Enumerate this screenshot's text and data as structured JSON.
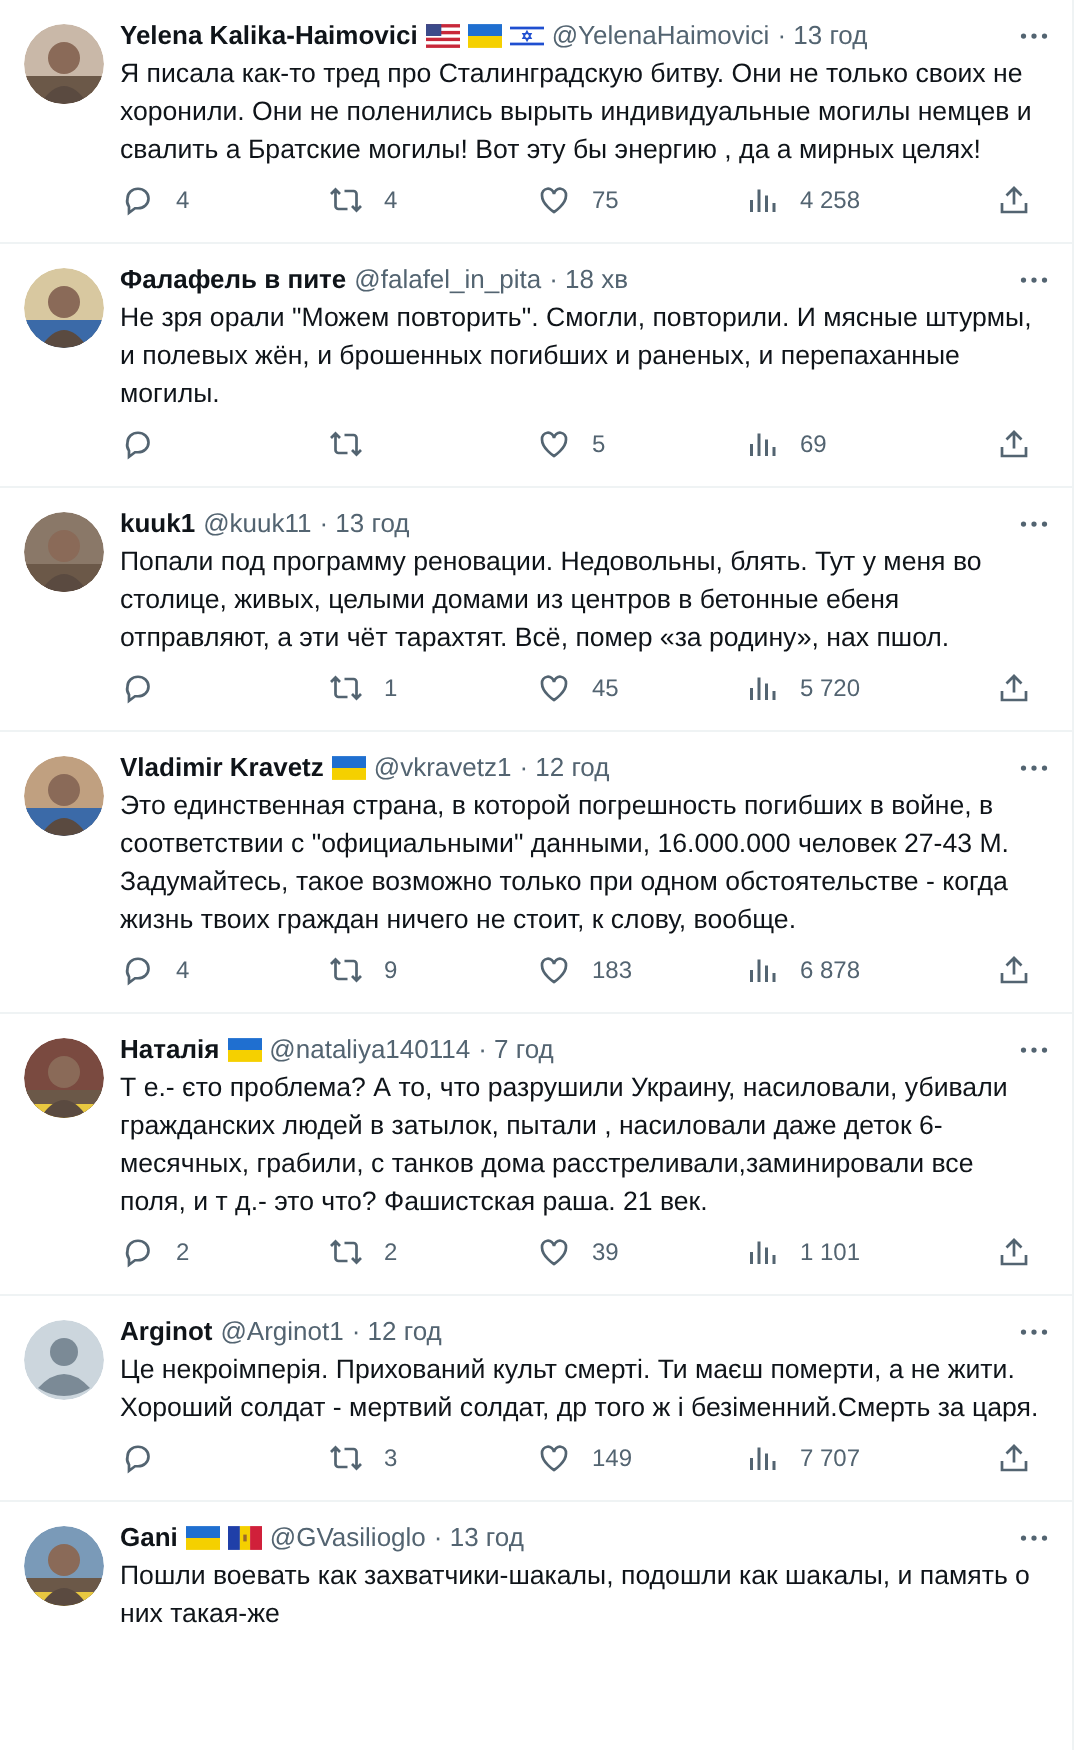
{
  "tweets": [
    {
      "name": "Yelena Kalika-Haimovici",
      "flags": [
        {
          "kind": "us"
        },
        {
          "kind": "ua"
        },
        {
          "kind": "il"
        }
      ],
      "handle": "@YelenaHaimovici",
      "time": "· 13 год",
      "avatar": {
        "kind": "picture"
      },
      "text": "Я писала как-то тред про Сталинградскую битву. Они не только своих не хоронили. Они не поленились вырыть индивидуальные могилы немцев и свалить а Братские могилы! Вот эту бы энергию , да а мирных целях!",
      "replies": "4",
      "retweets": "4",
      "likes": "75",
      "views": "4 258"
    },
    {
      "name": "Фалафель в пите",
      "handle": "@falafel_in_pita",
      "time": "· 18 хв",
      "avatar": {
        "kind": "picture"
      },
      "text": "Не зря орали \"Можем повторить\". Смогли, повторили. И мясные штурмы, и полевых жён, и брошенных погибших и раненых, и перепаханные могилы.",
      "likes": "5",
      "views": "69"
    },
    {
      "name": "kuuk1",
      "handle": "@kuuk11",
      "time": "· 13 год",
      "avatar": {
        "kind": "picture"
      },
      "text": "Попали под программу реновации. Недовольны, блять. Тут у меня во столице, живых, целыми домами из центров в бетонные ебеня отправляют, а эти чёт тарахтят. Всё, помер «за родину», нах пшол.",
      "retweets": "1",
      "likes": "45",
      "views": "5 720"
    },
    {
      "name": "Vladimir Kravetz",
      "flags": [
        {
          "kind": "ua"
        }
      ],
      "handle": "@vkravetz1",
      "time": "· 12 год",
      "avatar": {
        "kind": "picture"
      },
      "text": "Это единственная страна, в которой погрешность погибших в войне, в соответствии с \"официальными\" данными, 16.000.000 человек 27-43 М. Задумайтесь, такое возможно только при одном обстоятельстве - когда жизнь твоих граждан ничего не стоит, к слову, вообще.",
      "replies": "4",
      "retweets": "9",
      "likes": "183",
      "views": "6 878"
    },
    {
      "name": "Наталія",
      "flags": [
        {
          "kind": "ua"
        }
      ],
      "handle": "@nataliya140114",
      "time": "· 7 год",
      "avatar": {
        "kind": "picture"
      },
      "text": "Т е.- єто проблема? А то, что разрушили Украину, насиловали, убивали гражданских людей в затылок, пытали , насиловали даже деток 6-месячных, грабили, с танков дома расстреливали,заминировали все поля, и т д.- это что? Фашистская раша. 21 век.",
      "replies": "2",
      "retweets": "2",
      "likes": "39",
      "views": "1 101"
    },
    {
      "name": "Arginot",
      "handle": "@Arginot1",
      "time": "· 12 год",
      "avatar": {
        "kind": "default"
      },
      "text": "Це некроімперія. Прихований культ смерті. Ти маєш померти, а не жити. Хороший солдат - мертвий солдат, др того ж і безіменний.Смерть за царя.",
      "retweets": "3",
      "likes": "149",
      "views": "7 707"
    },
    {
      "name": "Gani",
      "flags": [
        {
          "kind": "ua"
        },
        {
          "kind": "md"
        }
      ],
      "handle": "@GVasilioglo",
      "time": "· 13 год",
      "avatar": {
        "kind": "picture"
      },
      "text": "Пошли воевать как захватчики-шакалы, подошли как шакалы, и память о них такая-же"
    }
  ]
}
